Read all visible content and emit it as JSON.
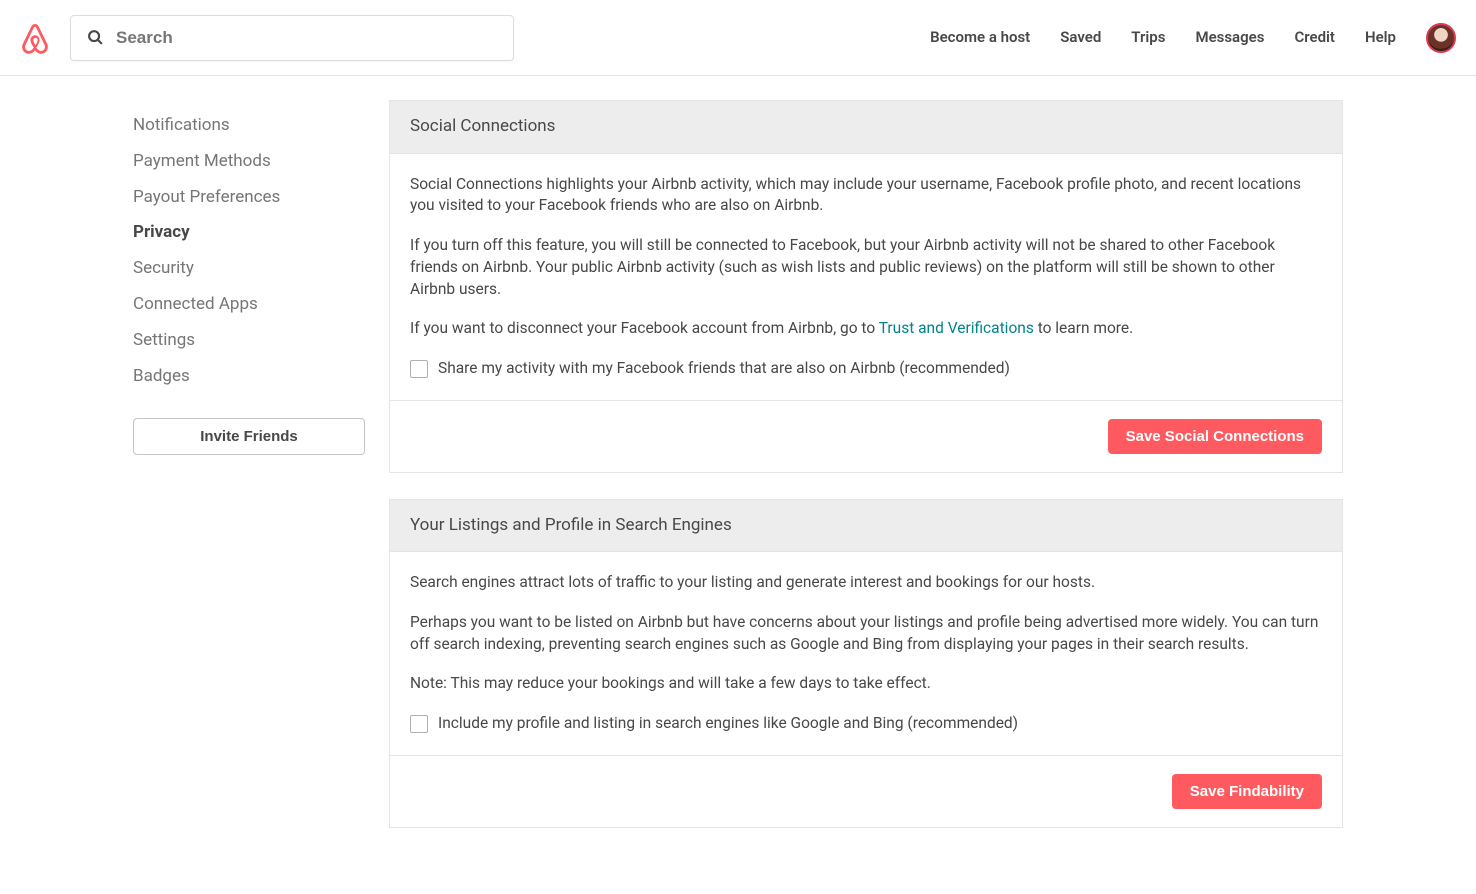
{
  "header": {
    "search_placeholder": "Search",
    "nav": [
      "Become a host",
      "Saved",
      "Trips",
      "Messages",
      "Credit",
      "Help"
    ]
  },
  "sidebar": {
    "items": [
      "Notifications",
      "Payment Methods",
      "Payout Preferences",
      "Privacy",
      "Security",
      "Connected Apps",
      "Settings",
      "Badges"
    ],
    "active_index": 3,
    "invite_label": "Invite Friends"
  },
  "panels": {
    "social": {
      "title": "Social Connections",
      "p1": "Social Connections highlights your Airbnb activity, which may include your username, Facebook profile photo, and recent locations you visited to your Facebook friends who are also on Airbnb.",
      "p2": "If you turn off this feature, you will still be connected to Facebook, but your Airbnb activity will not be shared to other Facebook friends on Airbnb. Your public Airbnb activity (such as wish lists and public reviews) on the platform will still be shown to other Airbnb users.",
      "p3_before": "If you want to disconnect your Facebook account from Airbnb, go to ",
      "p3_link": "Trust and Verifications",
      "p3_after": " to learn more.",
      "checkbox_label": "Share my activity with my Facebook friends that are also on Airbnb (recommended)",
      "save_label": "Save Social Connections"
    },
    "findability": {
      "title": "Your Listings and Profile in Search Engines",
      "p1": "Search engines attract lots of traffic to your listing and generate interest and bookings for our hosts.",
      "p2": "Perhaps you want to be listed on Airbnb but have concerns about your listings and profile being advertised more widely. You can turn off search indexing, preventing search engines such as Google and Bing from displaying your pages in their search results.",
      "p3": "Note: This may reduce your bookings and will take a few days to take effect.",
      "checkbox_label": "Include my profile and listing in search engines like Google and Bing (recommended)",
      "save_label": "Save Findability"
    }
  }
}
